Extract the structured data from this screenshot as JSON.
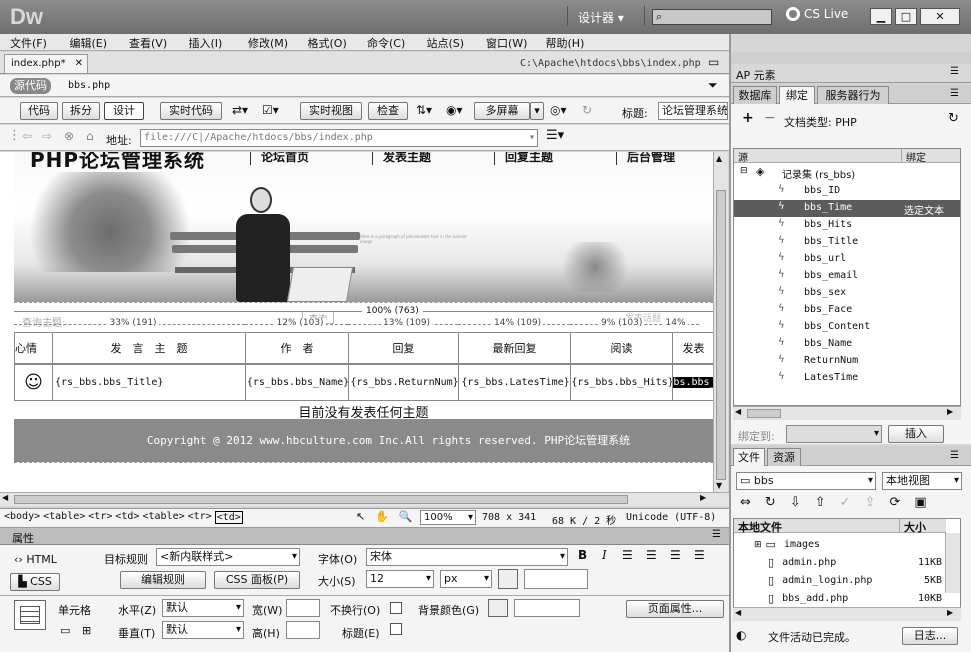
{
  "app": {
    "logo": "Dw",
    "workspace": "设计器",
    "search_placeholder": "",
    "cslive": "CS Live",
    "win_min": "▁",
    "win_max": "□",
    "win_close": "✕"
  },
  "menu": [
    "文件(F)",
    "编辑(E)",
    "查看(V)",
    "插入(I)",
    "修改(M)",
    "格式(O)",
    "命令(C)",
    "站点(S)",
    "窗口(W)",
    "帮助(H)"
  ],
  "doc": {
    "tab": "index.php*",
    "path": "C:\\Apache\\htdocs\\bbs\\index.php",
    "source_btn": "源代码",
    "related_file": "bbs.php"
  },
  "toolbar": {
    "code": "代码",
    "split": "拆分",
    "design": "设计",
    "live_code": "实时代码",
    "live_view": "实时视图",
    "inspect": "检查",
    "multiscreen": "多屏幕",
    "title_label": "标题:",
    "title_value": "论坛管理系统"
  },
  "address": {
    "label": "地址:",
    "value": "file:///C|/Apache/htdocs/bbs/index.php"
  },
  "page": {
    "brand": "PHP论坛管理系统",
    "nav": [
      "论坛首页",
      "发表主题",
      "回复主题",
      "后台管理"
    ],
    "blurb": "Here is a paragraph of placeholder text in the banner image",
    "search_label": "查询主题:",
    "search_btn": "查询",
    "post_btn": "发表话题",
    "width_total": "100% (763)",
    "col_widths": [
      "33% (191)",
      "12% (103)",
      "13% (109)",
      "14% (109)",
      "9% (103)",
      "14%"
    ],
    "headers": [
      "心情",
      "发　言　主　题",
      "作　者",
      "回复",
      "最新回复",
      "阅读",
      "发表"
    ],
    "row": [
      "{rs_bbs.bbs_Title}",
      "{rs_bbs.bbs_Name}",
      "{rs_bbs.ReturnNum}",
      "{rs_bbs.LatesTime}",
      "{rs_bbs.bbs_Hits}",
      "{rs_bbs.bbs_Time}"
    ],
    "empty_msg": "目前没有发表任何主题",
    "footer": "Copyright @ 2012 www.hbculture.com Inc.All rights reserved. PHP论坛管理系统"
  },
  "status": {
    "tags": [
      "<body>",
      "<table>",
      "<tr>",
      "<td>",
      "<table>",
      "<tr>",
      "<td>"
    ],
    "zoom": "100%",
    "size": "708 x 341",
    "weight": "68 K / 2 秒",
    "encoding": "Unicode (UTF-8)"
  },
  "props": {
    "title": "属性",
    "html": "HTML",
    "css": "CSS",
    "target_rule_label": "目标规则",
    "target_rule": "<新内联样式>",
    "edit_rule": "编辑规则",
    "css_panel": "CSS 面板(P)",
    "font_label": "字体(O)",
    "font_value": "宋体",
    "size_label": "大小(S)",
    "size_value": "12",
    "unit": "px",
    "cell_label": "单元格",
    "horz_label": "水平(Z)",
    "horz_value": "默认",
    "vert_label": "垂直(T)",
    "vert_value": "默认",
    "width_label": "宽(W)",
    "height_label": "高(H)",
    "nowrap_label": "不换行(O)",
    "header_label": "标题(E)",
    "bg_label": "背景颜色(G)",
    "page_props": "页面属性..."
  },
  "right": {
    "ap_tab": "AP 元素",
    "tabs": [
      "数据库",
      "绑定",
      "服务器行为"
    ],
    "doc_type_label": "文档类型: PHP",
    "col_source": "源",
    "col_binding": "绑定",
    "recordset": "记录集 (rs_bbs)",
    "fields": [
      "bbs_ID",
      "bbs_Time",
      "bbs_Hits",
      "bbs_Title",
      "bbs_url",
      "bbs_email",
      "bbs_sex",
      "bbs_Face",
      "bbs_Content",
      "bbs_Name",
      "ReturnNum",
      "LatesTime"
    ],
    "selected_binding": "选定文本",
    "bind_to": "绑定到:",
    "insert_btn": "插入",
    "file_tabs": [
      "文件",
      "资源"
    ],
    "site": "bbs",
    "view": "本地视图",
    "files_header": "本地文件",
    "size_header": "大小",
    "files": [
      {
        "name": "images",
        "size": ""
      },
      {
        "name": "admin.php",
        "size": "11KB"
      },
      {
        "name": "admin_login.php",
        "size": "5KB"
      },
      {
        "name": "bbs_add.php",
        "size": "10KB"
      }
    ],
    "status": "文件活动已完成。",
    "log_btn": "日志..."
  },
  "colors": {
    "selected_row": "#5c5c5c",
    "footer_band": "#8a8a8a"
  }
}
